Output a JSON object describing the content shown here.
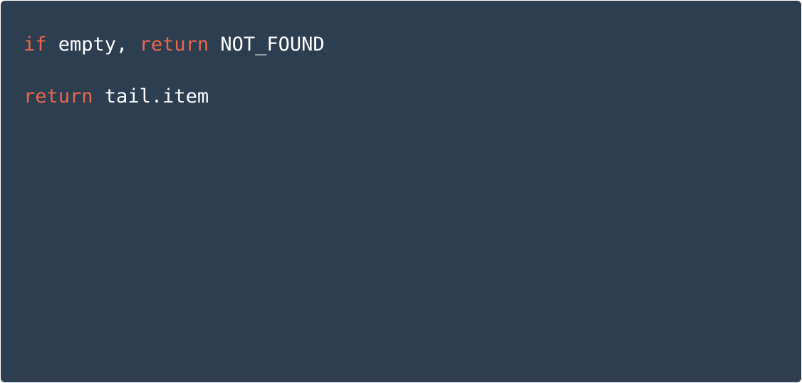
{
  "code": {
    "lines": [
      {
        "tokens": [
          {
            "text": "if",
            "kind": "keyword"
          },
          {
            "text": " empty, ",
            "kind": "text"
          },
          {
            "text": "return",
            "kind": "keyword"
          },
          {
            "text": " NOT_FOUND",
            "kind": "text"
          }
        ]
      },
      {
        "tokens": [
          {
            "text": "return",
            "kind": "keyword"
          },
          {
            "text": " tail.item",
            "kind": "text"
          }
        ]
      }
    ]
  },
  "colors": {
    "background": "#2c3e50",
    "keyword": "#e8674e",
    "text": "#ffffff"
  }
}
